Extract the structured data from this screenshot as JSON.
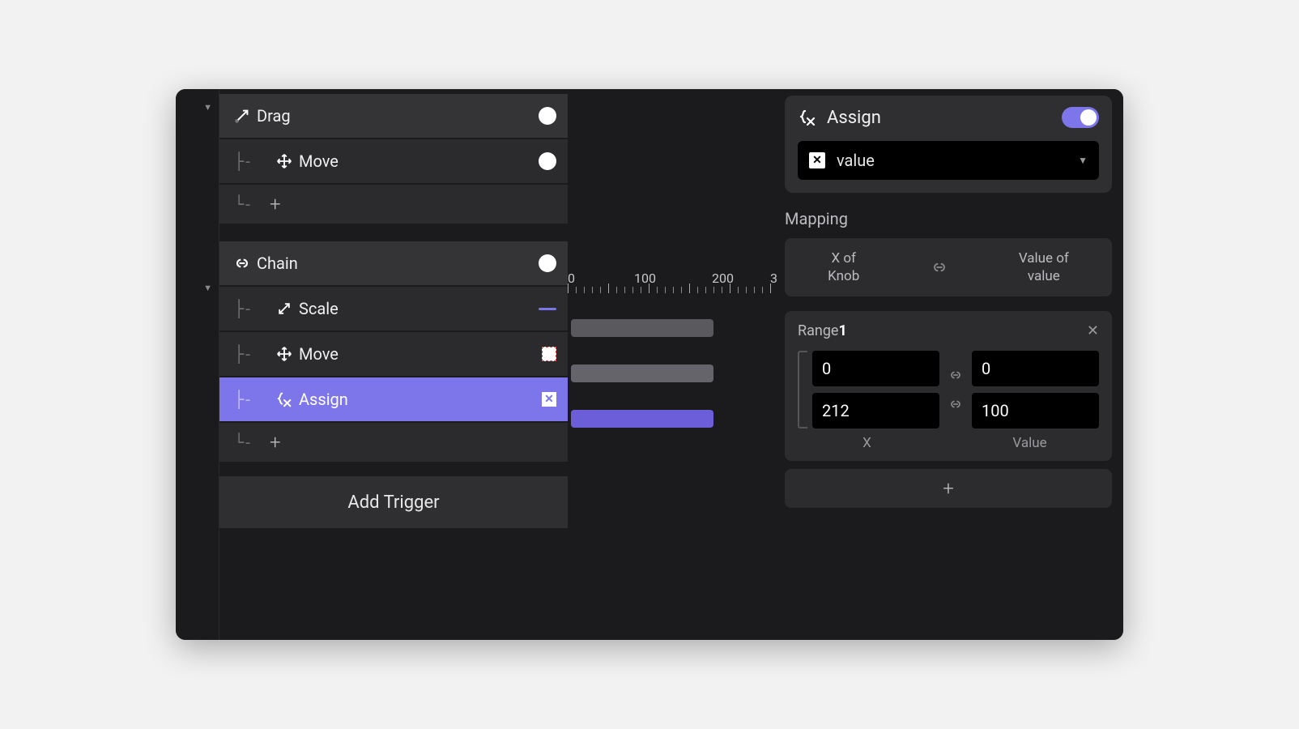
{
  "tree": {
    "drag": {
      "label": "Drag"
    },
    "drag_move": {
      "label": "Move"
    },
    "chain": {
      "label": "Chain"
    },
    "chain_scale": {
      "label": "Scale"
    },
    "chain_move": {
      "label": "Move"
    },
    "chain_assign": {
      "label": "Assign"
    },
    "add_trigger": "Add Trigger"
  },
  "timeline": {
    "ticks": [
      "0",
      "100",
      "200",
      "3"
    ]
  },
  "panel": {
    "title": "Assign",
    "value_select": "value",
    "mapping_label": "Mapping",
    "mapping": {
      "left_top": "X of",
      "left_bottom": "Knob",
      "right_top": "Value of",
      "right_bottom": "value"
    },
    "range": {
      "title_prefix": "Range",
      "title_num": "1",
      "from_x": "0",
      "from_value": "0",
      "to_x": "212",
      "to_value": "100",
      "x_label": "X",
      "value_label": "Value"
    }
  }
}
